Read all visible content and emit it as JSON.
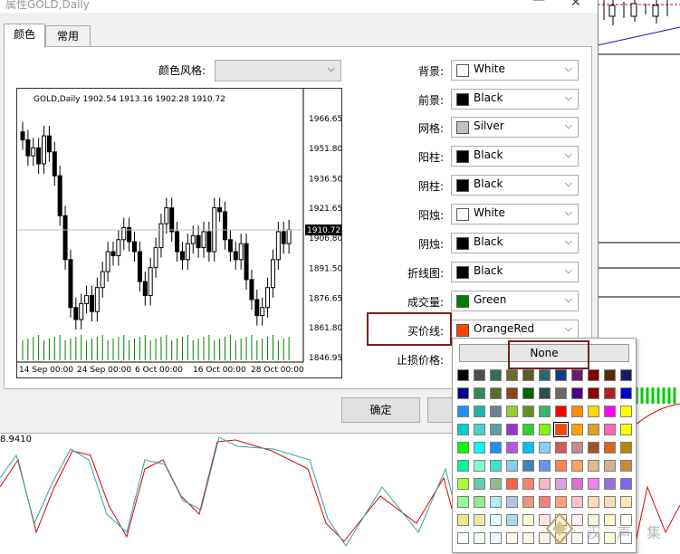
{
  "window": {
    "title": "属性GOLD,Daily"
  },
  "tabs": [
    {
      "label": "颜色",
      "active": true
    },
    {
      "label": "常用",
      "active": false
    }
  ],
  "scheme": {
    "label": "颜色风格:",
    "value": ""
  },
  "chart_preview": {
    "header": "GOLD,Daily   1902.54 1913.16 1902.28 1910.72",
    "price_ticks": [
      "1966.65",
      "1951.80",
      "1936.50",
      "1921.65",
      "1906.80",
      "1891.50",
      "1876.65",
      "1861.80",
      "1846.95"
    ],
    "current_price": "1910.72",
    "date_ticks": [
      "14 Sep 00:00",
      "24 Sep 00:00",
      "6 Oct 00:00",
      "16 Oct 00:00",
      "28 Oct 00:00"
    ]
  },
  "color_rows": [
    {
      "label": "背景:",
      "value": "White",
      "color": "#ffffff"
    },
    {
      "label": "前景:",
      "value": "Black",
      "color": "#000000"
    },
    {
      "label": "网格:",
      "value": "Silver",
      "color": "#c0c0c0"
    },
    {
      "label": "阳柱:",
      "value": "Black",
      "color": "#000000"
    },
    {
      "label": "阴柱:",
      "value": "Black",
      "color": "#000000"
    },
    {
      "label": "阳烛:",
      "value": "White",
      "color": "#ffffff"
    },
    {
      "label": "阴烛:",
      "value": "Black",
      "color": "#000000"
    },
    {
      "label": "折线图:",
      "value": "Black",
      "color": "#000000"
    },
    {
      "label": "成交量:",
      "value": "Green",
      "color": "#008000"
    },
    {
      "label": "买价线:",
      "value": "OrangeRed",
      "color": "#ff4500"
    },
    {
      "label": "止损价格:",
      "value": "",
      "color": ""
    }
  ],
  "buttons": {
    "ok": "确定"
  },
  "palette": {
    "none_label": "None"
  },
  "background_indicator": {
    "value_label": "8.9410"
  },
  "watermark": {
    "text": "汉 声 集 团"
  }
}
